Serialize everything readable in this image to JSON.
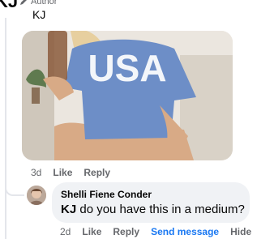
{
  "top_comment": {
    "author_initials": "KJ",
    "badge_label": "Author",
    "text": "KJ",
    "image": {
      "shirt_text": "USA",
      "colors": {
        "shirt": "#6d8ec7",
        "background": "#e9e5df",
        "skin": "#d8aa86",
        "hair": "#e7cf9f"
      }
    },
    "time": "3d",
    "like_label": "Like",
    "reply_label": "Reply"
  },
  "reply": {
    "author_name": "Shelli Fiene Conder",
    "mention": "KJ",
    "text": " do you have this in a medium?",
    "time": "2d",
    "like_label": "Like",
    "reply_label": "Reply",
    "send_message_label": "Send message",
    "hide_label": "Hide"
  },
  "colors": {
    "link_blue": "#1877f2",
    "muted": "#65676b",
    "bubble_bg": "#f0f2f5",
    "thread_line": "#e4e6eb"
  }
}
